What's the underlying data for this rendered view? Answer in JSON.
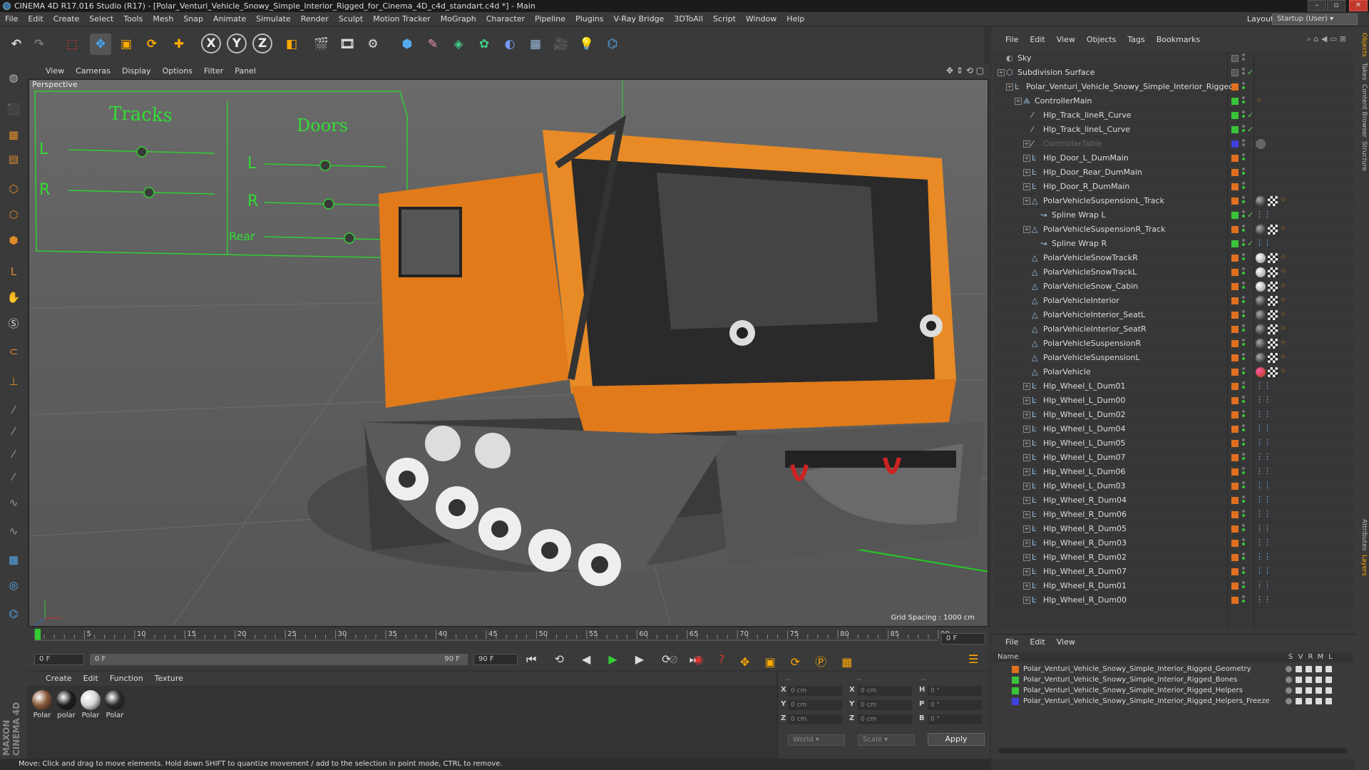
{
  "window": {
    "title": "CINEMA 4D R17.016 Studio (R17) - [Polar_Venturi_Vehicle_Snowy_Simple_Interior_Rigged_for_Cinema_4D_c4d_standart.c4d *] - Main"
  },
  "menubar": {
    "items": [
      "File",
      "Edit",
      "Create",
      "Select",
      "Tools",
      "Mesh",
      "Snap",
      "Animate",
      "Simulate",
      "Render",
      "Sculpt",
      "Motion Tracker",
      "MoGraph",
      "Character",
      "Pipeline",
      "Plugins",
      "V-Ray Bridge",
      "3DToAll",
      "Script",
      "Window",
      "Help"
    ],
    "layout_label": "Layout:",
    "layout_value": "Startup (User)"
  },
  "viewport": {
    "menu": [
      "View",
      "Cameras",
      "Display",
      "Options",
      "Filter",
      "Panel"
    ],
    "label": "Perspective",
    "grid_spacing": "Grid Spacing : 1000 cm",
    "hud": {
      "tracks_title": "Tracks",
      "doors_title": "Doors",
      "track_l": "L",
      "track_r": "R",
      "door_l": "L",
      "door_r": "R",
      "door_rear": "Rear"
    }
  },
  "timeline": {
    "ticks": [
      "0",
      "5",
      "10",
      "15",
      "20",
      "25",
      "30",
      "35",
      "40",
      "45",
      "50",
      "55",
      "60",
      "65",
      "70",
      "75",
      "80",
      "85",
      "90"
    ],
    "frame_end_field": "0 F",
    "current_frame": "0 F",
    "range_start": "0 F",
    "range_end_inner": "90 F",
    "range_end": "90 F"
  },
  "materials": {
    "menu": [
      "Create",
      "Edit",
      "Function",
      "Texture"
    ],
    "items": [
      {
        "label": "Polar",
        "color": "#8a5a3a"
      },
      {
        "label": "polar",
        "color": "#1e1e1e"
      },
      {
        "label": "Polar",
        "color": "#d8d8d8"
      },
      {
        "label": "Polar",
        "color": "#2a2a2a"
      }
    ]
  },
  "coordinates": {
    "headers": [
      "--",
      "--",
      "--"
    ],
    "rows": [
      {
        "a": "X",
        "av": "0 cm",
        "b": "X",
        "bv": "0 cm",
        "c": "H",
        "cv": "0 °"
      },
      {
        "a": "Y",
        "av": "0 cm",
        "b": "Y",
        "bv": "0 cm",
        "c": "P",
        "cv": "0 °"
      },
      {
        "a": "Z",
        "av": "0 cm",
        "b": "Z",
        "bv": "0 cm",
        "c": "B",
        "cv": "0 °"
      }
    ],
    "mode": "World",
    "type": "Scale",
    "apply": "Apply"
  },
  "status": {
    "text": "Move: Click and drag to move elements. Hold down SHIFT to quantize movement / add to the selection in point mode, CTRL to remove."
  },
  "object_manager": {
    "menu": [
      "File",
      "Edit",
      "View",
      "Objects",
      "Tags",
      "Bookmarks"
    ],
    "rows": [
      {
        "name": "Sky",
        "indent": 0,
        "icon": "sky",
        "layer": "",
        "exp": false
      },
      {
        "name": "Subdivision Surface",
        "indent": 0,
        "icon": "subd",
        "layer": "",
        "exp": true,
        "check": true
      },
      {
        "name": "Polar_Venturi_Vehicle_Snowy_Simple_Interior_Rigged",
        "indent": 1,
        "icon": "null",
        "layer": "#e07020",
        "exp": true
      },
      {
        "name": "ControllerMain",
        "indent": 2,
        "icon": "bone",
        "layer": "#3ac43a",
        "exp": true,
        "tags": [
          "dots"
        ]
      },
      {
        "name": "Hlp_Track_lineR_Curve",
        "indent": 3,
        "icon": "spline",
        "layer": "#3ac43a",
        "check": true
      },
      {
        "name": "Hlp_Track_lineL_Curve",
        "indent": 3,
        "icon": "spline",
        "layer": "#3ac43a",
        "check": true
      },
      {
        "name": "ControllerTable",
        "indent": 3,
        "icon": "spline",
        "layer": "#4040e0",
        "exp": true,
        "dim": true,
        "tags": [
          "gray"
        ]
      },
      {
        "name": "Hlp_Door_L_DumMain",
        "indent": 3,
        "icon": "null",
        "layer": "#e07020",
        "exp": true
      },
      {
        "name": "Hlp_Door_Rear_DumMain",
        "indent": 3,
        "icon": "null",
        "layer": "#e07020",
        "exp": true
      },
      {
        "name": "Hlp_Door_R_DumMain",
        "indent": 3,
        "icon": "null",
        "layer": "#e07020",
        "exp": true
      },
      {
        "name": "PolarVehicleSuspensionL_Track",
        "indent": 3,
        "icon": "poly",
        "layer": "#e07020",
        "exp": true,
        "tags": [
          "dark",
          "check",
          "dots"
        ]
      },
      {
        "name": "Spline Wrap L",
        "indent": 4,
        "icon": "wrap",
        "layer": "#3ac43a",
        "check": true,
        "tags": [
          "dots2"
        ]
      },
      {
        "name": "PolarVehicleSuspensionR_Track",
        "indent": 3,
        "icon": "poly",
        "layer": "#e07020",
        "exp": true,
        "tags": [
          "dark",
          "check",
          "dots"
        ]
      },
      {
        "name": "Spline Wrap R",
        "indent": 4,
        "icon": "wrap",
        "layer": "#3ac43a",
        "check": true,
        "tags": [
          "dots2"
        ]
      },
      {
        "name": "PolarVehicleSnowTrackR",
        "indent": 3,
        "icon": "poly",
        "layer": "#e07020",
        "tags": [
          "light",
          "check",
          "dots"
        ]
      },
      {
        "name": "PolarVehicleSnowTrackL",
        "indent": 3,
        "icon": "poly",
        "layer": "#e07020",
        "tags": [
          "light",
          "check",
          "dots"
        ]
      },
      {
        "name": "PolarVehicleSnow_Cabin",
        "indent": 3,
        "icon": "poly",
        "layer": "#e07020",
        "tags": [
          "light",
          "check",
          "dots"
        ]
      },
      {
        "name": "PolarVehicleInterior",
        "indent": 3,
        "icon": "poly",
        "layer": "#e07020",
        "tags": [
          "dark",
          "check",
          "dots"
        ]
      },
      {
        "name": "PolarVehicleInterior_SeatL",
        "indent": 3,
        "icon": "poly",
        "layer": "#e07020",
        "tags": [
          "dark",
          "check",
          "dots"
        ]
      },
      {
        "name": "PolarVehicleInterior_SeatR",
        "indent": 3,
        "icon": "poly",
        "layer": "#e07020",
        "tags": [
          "dark",
          "check",
          "dots"
        ]
      },
      {
        "name": "PolarVehicleSuspensionR",
        "indent": 3,
        "icon": "poly",
        "layer": "#e07020",
        "tags": [
          "dark",
          "check",
          "dots"
        ]
      },
      {
        "name": "PolarVehicleSuspensionL",
        "indent": 3,
        "icon": "poly",
        "layer": "#e07020",
        "tags": [
          "dark",
          "check",
          "dots"
        ]
      },
      {
        "name": "PolarVehicle",
        "indent": 3,
        "icon": "poly",
        "layer": "#e07020",
        "tags": [
          "orange",
          "check",
          "dots"
        ]
      },
      {
        "name": "Hlp_Wheel_L_Dum01",
        "indent": 3,
        "icon": "null",
        "layer": "#e07020",
        "exp": true,
        "tags": [
          "dots2"
        ]
      },
      {
        "name": "Hlp_Wheel_L_Dum00",
        "indent": 3,
        "icon": "null",
        "layer": "#e07020",
        "exp": true,
        "tags": [
          "dots2"
        ]
      },
      {
        "name": "Hlp_Wheel_L_Dum02",
        "indent": 3,
        "icon": "null",
        "layer": "#e07020",
        "exp": true,
        "tags": [
          "dots2"
        ]
      },
      {
        "name": "Hlp_Wheel_L_Dum04",
        "indent": 3,
        "icon": "null",
        "layer": "#e07020",
        "exp": true,
        "tags": [
          "dots2"
        ]
      },
      {
        "name": "Hlp_Wheel_L_Dum05",
        "indent": 3,
        "icon": "null",
        "layer": "#e07020",
        "exp": true,
        "tags": [
          "dots2"
        ]
      },
      {
        "name": "Hlp_Wheel_L_Dum07",
        "indent": 3,
        "icon": "null",
        "layer": "#e07020",
        "exp": true,
        "tags": [
          "dots2"
        ]
      },
      {
        "name": "Hlp_Wheel_L_Dum06",
        "indent": 3,
        "icon": "null",
        "layer": "#e07020",
        "exp": true,
        "tags": [
          "dots2"
        ]
      },
      {
        "name": "Hlp_Wheel_L_Dum03",
        "indent": 3,
        "icon": "null",
        "layer": "#e07020",
        "exp": true,
        "tags": [
          "dots2"
        ]
      },
      {
        "name": "Hlp_Wheel_R_Dum04",
        "indent": 3,
        "icon": "null",
        "layer": "#e07020",
        "exp": true,
        "tags": [
          "dots2"
        ]
      },
      {
        "name": "Hlp_Wheel_R_Dum06",
        "indent": 3,
        "icon": "null",
        "layer": "#e07020",
        "exp": true,
        "tags": [
          "dots2"
        ]
      },
      {
        "name": "Hlp_Wheel_R_Dum05",
        "indent": 3,
        "icon": "null",
        "layer": "#e07020",
        "exp": true,
        "tags": [
          "dots2"
        ]
      },
      {
        "name": "Hlp_Wheel_R_Dum03",
        "indent": 3,
        "icon": "null",
        "layer": "#e07020",
        "exp": true,
        "tags": [
          "dots2"
        ]
      },
      {
        "name": "Hlp_Wheel_R_Dum02",
        "indent": 3,
        "icon": "null",
        "layer": "#e07020",
        "exp": true,
        "tags": [
          "dots2"
        ]
      },
      {
        "name": "Hlp_Wheel_R_Dum07",
        "indent": 3,
        "icon": "null",
        "layer": "#e07020",
        "exp": true,
        "tags": [
          "dots2"
        ]
      },
      {
        "name": "Hlp_Wheel_R_Dum01",
        "indent": 3,
        "icon": "null",
        "layer": "#e07020",
        "exp": true,
        "tags": [
          "dots2"
        ]
      },
      {
        "name": "Hlp_Wheel_R_Dum00",
        "indent": 3,
        "icon": "null",
        "layer": "#e07020",
        "exp": true,
        "tags": [
          "dots2"
        ]
      }
    ]
  },
  "layer_manager": {
    "menu": [
      "File",
      "Edit",
      "View"
    ],
    "header_name": "Name",
    "header_flags": [
      "S",
      "V",
      "R",
      "M",
      "L"
    ],
    "rows": [
      {
        "name": "Polar_Venturi_Vehicle_Snowy_Simple_Interior_Rigged_Geometry",
        "color": "#e07020"
      },
      {
        "name": "Polar_Venturi_Vehicle_Snowy_Simple_Interior_Rigged_Bones",
        "color": "#3ac43a"
      },
      {
        "name": "Polar_Venturi_Vehicle_Snowy_Simple_Interior_Rigged_Helpers",
        "color": "#3ac43a"
      },
      {
        "name": "Polar_Venturi_Vehicle_Snowy_Simple_Interior_Rigged_Helpers_Freeze",
        "color": "#4040e0"
      }
    ]
  },
  "side_tabs": [
    "Objects",
    "Takes",
    "Content Browser",
    "Structure",
    "Attributes",
    "Layers"
  ]
}
